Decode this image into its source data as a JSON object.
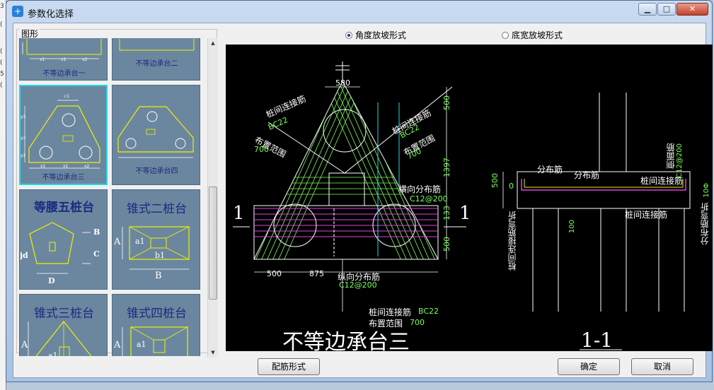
{
  "window": {
    "title": "参数化选择",
    "icon": "plus-app-icon",
    "minimize": "▁",
    "maximize": "□",
    "close": "✕"
  },
  "left_strip": {
    "chars": [
      "3",
      "(",
      "5",
      "(",
      "(",
      "("
    ]
  },
  "shapes_group": {
    "label": "图形",
    "items": [
      {
        "name": "不等边承台一",
        "selected": false
      },
      {
        "name": "不等边承台二",
        "selected": false
      },
      {
        "name": "不等边承台三",
        "selected": true
      },
      {
        "name": "不等边承台四",
        "selected": false
      },
      {
        "name": "等腰五桩台",
        "selected": false
      },
      {
        "name": "锥式二桩台",
        "selected": false
      },
      {
        "name": "锥式三桩台",
        "selected": false
      },
      {
        "name": "锥式四桩台",
        "selected": false
      }
    ],
    "dims": {
      "B": "B",
      "C": "C",
      "D": "D",
      "jd": "jd",
      "A": "A",
      "a1": "a1",
      "b1": "b1"
    },
    "mini": {
      "c1": "c1",
      "x1": "x1",
      "x2": "x2",
      "y1": "y1",
      "y2": "y2",
      "y3": "y3"
    }
  },
  "radio_options": [
    {
      "label": "角度放坡形式",
      "checked": true
    },
    {
      "label": "底宽放坡形式",
      "checked": false
    }
  ],
  "drawing": {
    "title": "不等边承台三",
    "section_title": "1-1",
    "section_mark": "1",
    "dims": {
      "top_width": "580",
      "right_top": "500",
      "right_mid": "1397",
      "right_low": "133",
      "right_bot": "500",
      "bottom_left": "500",
      "bottom_mid": "875",
      "left_height": "500",
      "left_zero": "0",
      "left_small": "100",
      "side_right": "10Φ",
      "side_right2": "C12@200"
    },
    "labels": {
      "pile_link_left": "桩间连接筋",
      "pile_link_left_val": "BC22",
      "range_left": "布置范围",
      "range_left_val": "700",
      "pile_link_right": "桩间连接筋",
      "pile_link_right_val": "BC22",
      "range_right": "布置范围",
      "range_right_val": "700",
      "horiz_dist": "横向分布筋",
      "horiz_dist_val": "C12@200",
      "vert_dist": "纵向分布筋",
      "vert_dist_val": "C12@200",
      "pile_link_bottom": "桩间连接筋",
      "pile_link_bottom_val": "BC22",
      "range_bottom": "布置范围",
      "range_bottom_val": "700",
      "sec_dist1": "分布筋",
      "sec_dist2": "分布筋",
      "sec_side": "侧面筋",
      "sec_link": "桩间连接筋",
      "sec_link_bottom": "桩间连接筋",
      "sec_left_bend": "桩间连接筋弯折",
      "sec_right_bend": "分布筋弯折"
    }
  },
  "buttons": {
    "rebar_form": "配筋形式",
    "ok": "确定",
    "cancel": "取消"
  }
}
